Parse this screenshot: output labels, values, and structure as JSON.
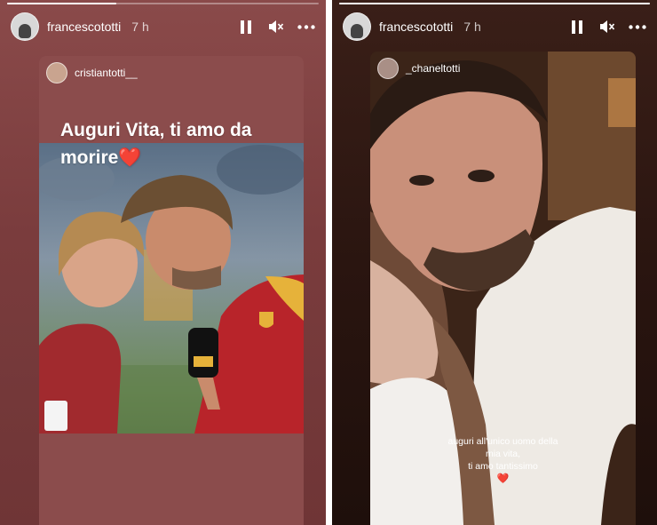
{
  "left_story": {
    "username": "francescototti",
    "time": "7 h",
    "progress": 0.35,
    "repost": {
      "username": "cristiantotti__",
      "caption_line1": "Auguri Vita, ti amo da",
      "caption_line2": "morire",
      "caption_emoji": "❤️"
    }
  },
  "right_story": {
    "username": "francescototti",
    "time": "7 h",
    "progress": 1,
    "repost": {
      "username": "_chaneltotti",
      "caption_line1": "auguri all'unico uomo della",
      "caption_line2": "mia vita,",
      "caption_line3": "ti amo tantissimo",
      "caption_emoji": "❤️"
    }
  },
  "icons": {
    "pause": "pause-icon",
    "mute": "speaker-muted-icon",
    "more": "more-options-icon"
  },
  "colors": {
    "left_background": "#7a3c3d",
    "right_background": "#2a1510",
    "jersey_red": "#b8242a",
    "heart_red": "#e0302f"
  }
}
